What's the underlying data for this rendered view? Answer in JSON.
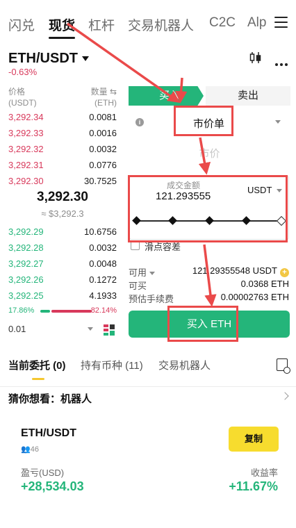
{
  "top_tabs": [
    "闪兑",
    "现货",
    "杠杆",
    "交易机器人",
    "C2C",
    "Alp"
  ],
  "pair": {
    "name": "ETH/USDT",
    "change": "-0.63%"
  },
  "orderbook": {
    "price_label": "价格",
    "price_unit": "(USDT)",
    "qty_label": "数量 ⇆",
    "qty_unit": "(ETH)",
    "asks": [
      {
        "price": "3,292.34",
        "qty": "0.0081"
      },
      {
        "price": "3,292.33",
        "qty": "0.0016"
      },
      {
        "price": "3,292.32",
        "qty": "0.0032"
      },
      {
        "price": "3,292.31",
        "qty": "0.0776"
      },
      {
        "price": "3,292.30",
        "qty": "30.7525"
      }
    ],
    "last_price": "3,292.30",
    "last_usd": "≈ $3,292.3",
    "bids": [
      {
        "price": "3,292.29",
        "qty": "10.6756"
      },
      {
        "price": "3,292.28",
        "qty": "0.0032"
      },
      {
        "price": "3,292.27",
        "qty": "0.0048"
      },
      {
        "price": "3,292.26",
        "qty": "0.1272"
      },
      {
        "price": "3,292.25",
        "qty": "4.1933"
      }
    ],
    "buy_ratio": "17.86%",
    "sell_ratio": "82.14%",
    "precision": "0.01"
  },
  "order_panel": {
    "buy_tab": "买入",
    "sell_tab": "卖出",
    "order_type": "市价单",
    "market_price_placeholder": "市价",
    "amount_label": "成交金额",
    "amount_value": "121.293555",
    "amount_unit": "USDT",
    "slippage_label": "滑点容差",
    "available_label": "可用",
    "available_value": "121.29355548 USDT",
    "can_buy_label": "可买",
    "can_buy_value": "0.0368 ETH",
    "fee_label": "预估手续费",
    "fee_value": "0.00002763 ETH",
    "buy_button": "买入 ETH"
  },
  "bottom_tabs": [
    "当前委托 (0)",
    "持有币种 (11)",
    "交易机器人"
  ],
  "guess": "猜你想看：机器人",
  "bot_card": {
    "pair": "ETH/USDT",
    "users": "46",
    "copy_button": "复制",
    "pnl_label": "盈亏(USD)",
    "pnl_value": "+28,534.03",
    "yield_label": "收益率",
    "yield_value": "+11.67%"
  },
  "colors": {
    "green": "#24b57a",
    "red": "#d8395b",
    "annotation": "#ea4a4a",
    "copy_yellow": "#f7dc2e"
  }
}
